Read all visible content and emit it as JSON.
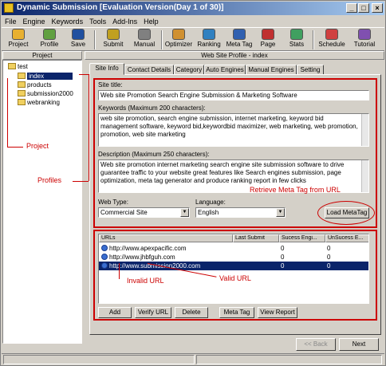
{
  "window": {
    "title": "Dynamic Submission [Evaluation Version(Day 1 of 30)]",
    "controls": [
      "_",
      "□",
      "×"
    ]
  },
  "menu": [
    "File",
    "Engine",
    "Keywords",
    "Tools",
    "Add-Ins",
    "Help"
  ],
  "toolbar": {
    "buttons": [
      {
        "label": "Project",
        "icon": "project-icon",
        "color": "#e8b030"
      },
      {
        "label": "Profile",
        "icon": "profile-icon",
        "color": "#60a040"
      },
      {
        "label": "Save",
        "icon": "save-icon",
        "color": "#2050a0"
      },
      {
        "label": "Submit",
        "icon": "submit-icon",
        "color": "#c0a020"
      },
      {
        "label": "Manual",
        "icon": "manual-icon",
        "color": "#808080"
      },
      {
        "label": "Optimizer",
        "icon": "optimizer-icon",
        "color": "#d09030"
      },
      {
        "label": "Ranking",
        "icon": "ranking-icon",
        "color": "#3080c0"
      },
      {
        "label": "Meta Tag",
        "icon": "metatag-icon",
        "color": "#3060b0"
      },
      {
        "label": "Page",
        "icon": "page-icon",
        "color": "#c03030"
      },
      {
        "label": "Stats",
        "icon": "stats-icon",
        "color": "#40a060"
      },
      {
        "label": "Schedule",
        "icon": "schedule-icon",
        "color": "#d04040"
      },
      {
        "label": "Tutorial",
        "icon": "tutorial-icon",
        "color": "#8050b0"
      }
    ]
  },
  "project_pane": {
    "header": "Project",
    "root": "test",
    "profiles": [
      "index",
      "products",
      "submission2000",
      "webranking"
    ],
    "selected": "index"
  },
  "profile_pane": {
    "header": "Web Site Profile - index",
    "tabs": [
      "Site Info",
      "Contact Details",
      "Category",
      "Auto Engines",
      "Manual Engines",
      "Setting"
    ],
    "active_tab": "Site Info"
  },
  "site_info": {
    "title_label": "Site title:",
    "title_value": "Web site Promotion Search Engine Submission & Marketing Software",
    "keywords_label": "Keywords (Maximum 200 characters):",
    "keywords_value": "web site promotion, search engine submission, internet marketing, keyword bid management software, keyword bid,keywordbid maximizer, web marketing, web promotion, promotion, web site marketing",
    "description_label": "Description (Maximum 250 characters):",
    "description_value": "Web site promotion internet marketing search engine site submission software to drive guarantee traffic to your website great features like Search engines submission, page optimization, meta tag generator and produce ranking report in few clicks",
    "web_type_label": "Web Type:",
    "web_type_value": "Commercial Site",
    "language_label": "Language:",
    "language_value": "English",
    "load_meta_tag": "Load MetaTag"
  },
  "urls": {
    "columns": [
      "URLs",
      "Last Submit",
      "Sucess Engi...",
      "UnSucess E..."
    ],
    "rows": [
      {
        "url": "http://www.apexpacific.com",
        "last": "",
        "success": "0",
        "unsuccess": "0"
      },
      {
        "url": "http://www.jhbfguh.com",
        "last": "",
        "success": "0",
        "unsuccess": "0"
      },
      {
        "url": "http://www.submission2000.com",
        "last": "",
        "success": "0",
        "unsuccess": "0"
      }
    ],
    "selected_index": 2,
    "buttons": [
      "Add",
      "Verify URL",
      "Delete",
      "Meta Tag",
      "View Report"
    ]
  },
  "annotations": {
    "project": "Project",
    "profiles": "Profiles",
    "retrieve": "Retrieve Meta Tag from URL",
    "invalid": "Invalid URL",
    "valid": "Valid URL"
  },
  "wizard": {
    "back": "<< Back",
    "next": "Next"
  },
  "colors": {
    "annotation": "#cc0000",
    "selection": "#0a246a",
    "title_start": "#0a246a",
    "title_end": "#a6caf0"
  }
}
